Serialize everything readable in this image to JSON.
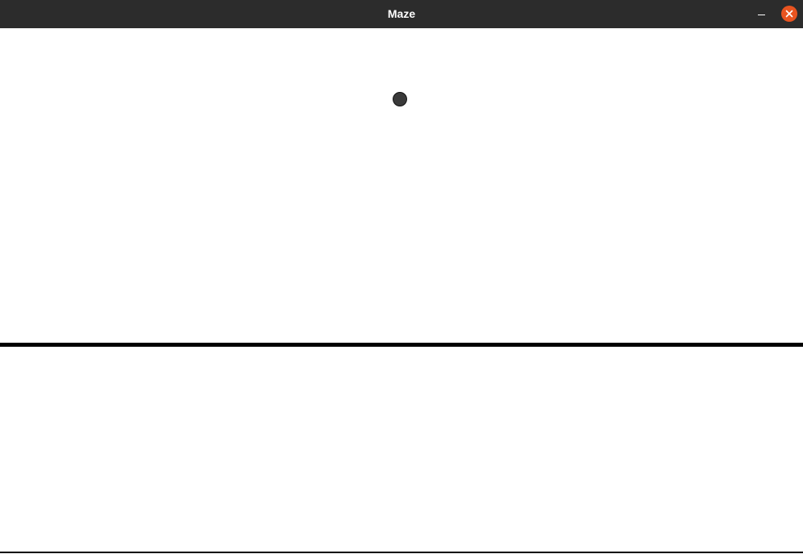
{
  "window": {
    "title": "Maze"
  },
  "controls": {
    "minimize_icon": "minimize-icon",
    "close_icon": "close-icon",
    "close_color": "#e95420"
  },
  "game": {
    "player": "ball",
    "player_color": "#3a3a3a",
    "wall_color": "#000000",
    "background_color": "#ffffff"
  }
}
